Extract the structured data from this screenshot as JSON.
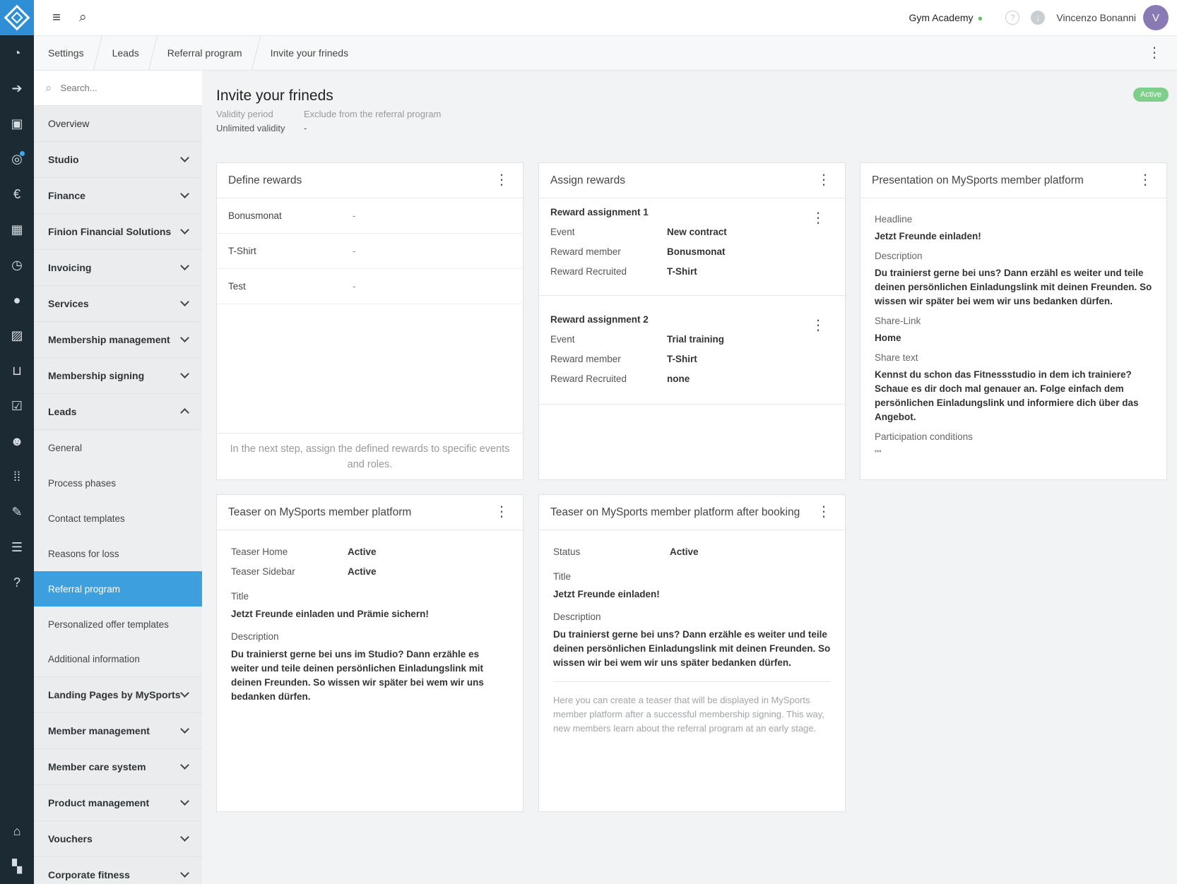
{
  "topbar": {
    "studio": "Gym Academy",
    "user_name": "Vincenzo Bonanni",
    "avatar_initial": "V"
  },
  "breadcrumb": [
    "Settings",
    "Leads",
    "Referral program",
    "Invite your frineds"
  ],
  "sidebar": {
    "search_placeholder": "Search...",
    "overview": "Overview",
    "groups_top": [
      "Studio",
      "Finance",
      "Finion Financial Solutions",
      "Invoicing",
      "Services",
      "Membership management",
      "Membership signing"
    ],
    "leads": "Leads",
    "leads_items": [
      "General",
      "Process phases",
      "Contact templates",
      "Reasons for loss",
      "Referral program",
      "Personalized offer templates",
      "Additional information"
    ],
    "groups_bottom": [
      "Landing Pages by MySports",
      "Member management",
      "Member care system",
      "Product management",
      "Vouchers",
      "Corporate fitness"
    ]
  },
  "page": {
    "title": "Invite your frineds",
    "status": "Active",
    "validity_label": "Validity period",
    "validity_value": "Unlimited validity",
    "exclude_label": "Exclude from the referral program",
    "exclude_value": "-"
  },
  "define_rewards": {
    "title": "Define rewards",
    "rows": [
      {
        "name": "Bonusmonat",
        "value": "-"
      },
      {
        "name": "T-Shirt",
        "value": "-"
      },
      {
        "name": "Test",
        "value": "-"
      }
    ],
    "footnote": "In the next step, assign the defined rewards to specific events and roles."
  },
  "assign_rewards": {
    "title": "Assign rewards",
    "assignments": [
      {
        "title": "Reward assignment 1",
        "event_label": "Event",
        "event": "New contract",
        "member_label": "Reward member",
        "member": "Bonusmonat",
        "recruited_label": "Reward Recruited",
        "recruited": "T-Shirt"
      },
      {
        "title": "Reward assignment 2",
        "event_label": "Event",
        "event": "Trial training",
        "member_label": "Reward member",
        "member": "T-Shirt",
        "recruited_label": "Reward Recruited",
        "recruited": "none"
      }
    ]
  },
  "presentation": {
    "title": "Presentation on MySports member platform",
    "headline_label": "Headline",
    "headline": "Jetzt Freunde einladen!",
    "description_label": "Description",
    "description": "Du trainierst gerne bei uns? Dann erzähl es weiter und teile deinen persönlichen Einladungslink mit deinen Freunden. So wissen wir später bei wem wir uns bedanken dürfen.",
    "share_link_label": "Share-Link",
    "share_link": "Home",
    "share_text_label": "Share text",
    "share_text": "Kennst du schon das Fitnessstudio in dem ich trainiere? Schaue es dir doch mal genauer an. Folge einfach dem persönlichen Einladungslink und informiere dich über das Angebot.",
    "conditions_label": "Participation conditions",
    "conditions": "\"\""
  },
  "teaser": {
    "title": "Teaser on MySports member platform",
    "home_label": "Teaser Home",
    "home": "Active",
    "sidebar_label": "Teaser Sidebar",
    "sidebar": "Active",
    "title_label": "Title",
    "title_value": "Jetzt Freunde einladen und Prämie sichern!",
    "description_label": "Description",
    "description": "Du trainierst gerne bei uns im Studio? Dann erzähle es weiter und teile deinen persönlichen Einladungslink mit deinen Freunden. So wissen wir später bei wem wir uns bedanken dürfen."
  },
  "teaser_after": {
    "title": "Teaser on MySports member platform after booking",
    "status_label": "Status",
    "status": "Active",
    "title_label": "Title",
    "title_value": "Jetzt Freunde einladen!",
    "description_label": "Description",
    "description": "Du trainierst gerne bei uns? Dann erzähle es weiter und teile deinen persönlichen Einladungslink mit deinen Freunden. So wissen wir bei wem wir uns später bedanken dürfen.",
    "hint": "Here you can create a teaser that will be displayed in MySports member platform after a successful membership signing. This way, new members learn about the referral program at an early stage."
  },
  "colors": {
    "rail": "#1b2a33",
    "accent": "#3d9fdd",
    "active_badge": "#7dcf8a"
  }
}
